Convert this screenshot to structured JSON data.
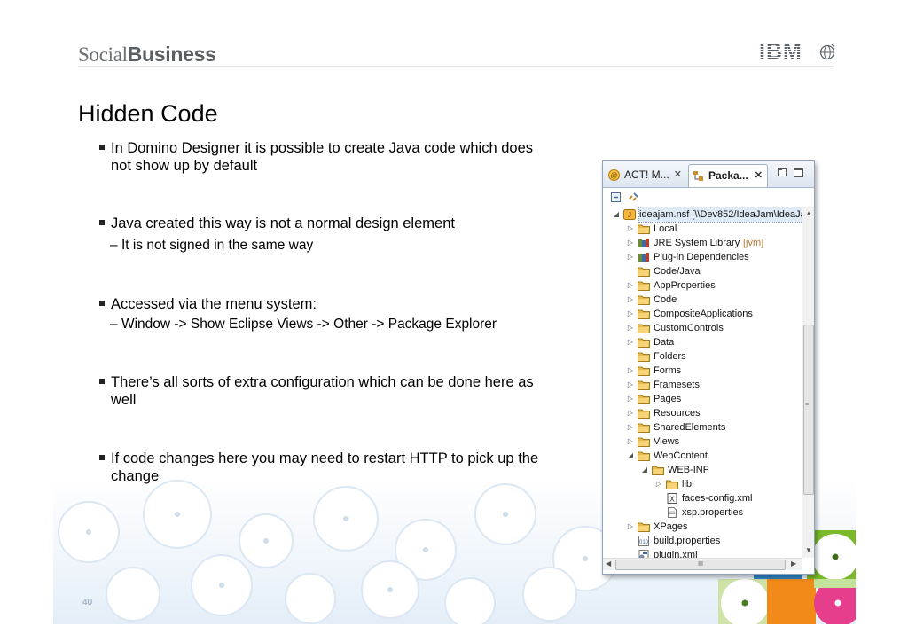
{
  "header": {
    "brand_light": "Social",
    "brand_bold": "Business",
    "logo": "IBM"
  },
  "title": "Hidden Code",
  "bullets": [
    {
      "text": "In Domino Designer it is possible to create Java code which does not show up by default",
      "subs": []
    },
    {
      "text": "Java created this way is not a normal design element",
      "subs": [
        "It is not signed in the same way"
      ]
    },
    {
      "text": "Accessed via the menu system:",
      "subs": [
        "Window -> Show Eclipse Views -> Other -> Package Explorer"
      ]
    },
    {
      "text": "There’s all sorts of extra configuration which can be done here as well",
      "subs": []
    },
    {
      "text": "If code changes here you may need to restart HTTP to pick up the change",
      "subs": []
    }
  ],
  "page_number": "40",
  "ide": {
    "tabs": [
      {
        "label": "ACT! M...",
        "icon": "act-icon",
        "close": "✕"
      },
      {
        "label": "Packa...",
        "icon": "package-explorer-icon",
        "close": "✕"
      }
    ],
    "scroll_glyph": "III",
    "tree": [
      {
        "label": "ideajam.nsf [\\\\Dev852/IdeaJam\\IdeaJa",
        "icon": "nsf-icon",
        "depth": 0,
        "twisty": "◢",
        "selected": true
      },
      {
        "label": "Local",
        "icon": "folder-icon",
        "depth": 1,
        "twisty": "▷"
      },
      {
        "label": "JRE System Library",
        "decoration": "[jvm]",
        "icon": "library-icon",
        "depth": 1,
        "twisty": "▷"
      },
      {
        "label": "Plug-in Dependencies",
        "icon": "library-icon",
        "depth": 1,
        "twisty": "▷"
      },
      {
        "label": "Code/Java",
        "icon": "folder-icon",
        "depth": 1,
        "twisty": ""
      },
      {
        "label": "AppProperties",
        "icon": "folder-icon",
        "depth": 1,
        "twisty": "▷"
      },
      {
        "label": "Code",
        "icon": "folder-icon",
        "depth": 1,
        "twisty": "▷"
      },
      {
        "label": "CompositeApplications",
        "icon": "folder-icon",
        "depth": 1,
        "twisty": "▷"
      },
      {
        "label": "CustomControls",
        "icon": "folder-icon",
        "depth": 1,
        "twisty": "▷"
      },
      {
        "label": "Data",
        "icon": "folder-icon",
        "depth": 1,
        "twisty": "▷"
      },
      {
        "label": "Folders",
        "icon": "folder-icon",
        "depth": 1,
        "twisty": ""
      },
      {
        "label": "Forms",
        "icon": "folder-icon",
        "depth": 1,
        "twisty": "▷"
      },
      {
        "label": "Framesets",
        "icon": "folder-icon",
        "depth": 1,
        "twisty": "▷"
      },
      {
        "label": "Pages",
        "icon": "folder-icon",
        "depth": 1,
        "twisty": "▷"
      },
      {
        "label": "Resources",
        "icon": "folder-icon",
        "depth": 1,
        "twisty": "▷"
      },
      {
        "label": "SharedElements",
        "icon": "folder-icon",
        "depth": 1,
        "twisty": "▷"
      },
      {
        "label": "Views",
        "icon": "folder-icon",
        "depth": 1,
        "twisty": "▷"
      },
      {
        "label": "WebContent",
        "icon": "folder-icon",
        "depth": 1,
        "twisty": "◢"
      },
      {
        "label": "WEB-INF",
        "icon": "folder-icon",
        "depth": 2,
        "twisty": "◢"
      },
      {
        "label": "lib",
        "icon": "folder-icon",
        "depth": 3,
        "twisty": "▷"
      },
      {
        "label": "faces-config.xml",
        "icon": "xml-file-icon",
        "depth": 3,
        "twisty": ""
      },
      {
        "label": "xsp.properties",
        "icon": "file-icon",
        "depth": 3,
        "twisty": ""
      },
      {
        "label": "XPages",
        "icon": "folder-icon",
        "depth": 1,
        "twisty": "▷"
      },
      {
        "label": "build.properties",
        "icon": "properties-file-icon",
        "depth": 1,
        "twisty": ""
      },
      {
        "label": "plugin.xml",
        "icon": "plugin-file-icon",
        "depth": 1,
        "twisty": ""
      }
    ]
  },
  "colors": {
    "folder": "#e8b84a",
    "accent_blue": "#3a7fc4",
    "accent_green": "#7ab929",
    "accent_orange": "#f08a1c"
  }
}
